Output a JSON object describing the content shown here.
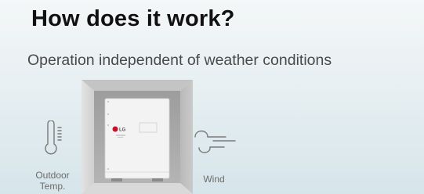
{
  "header": {
    "title": "How does it work?",
    "subtitle": "Operation independent of weather conditions"
  },
  "unit": {
    "brand": "LG"
  },
  "labels": {
    "outdoor_line1": "Outdoor",
    "outdoor_line2": "Temp.",
    "wind": "Wind"
  },
  "icons": {
    "temperature": "thermometer-icon",
    "wind": "wind-icon"
  },
  "colors": {
    "brand_red": "#c8102e",
    "wall_gray": "#a9a9a9",
    "icon_stroke": "#7a7a7a"
  }
}
